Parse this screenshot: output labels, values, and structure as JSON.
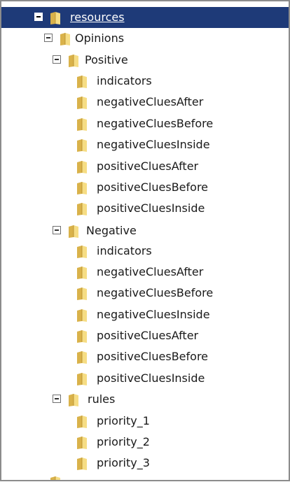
{
  "tree": {
    "root": {
      "label": "resources",
      "expanded": true,
      "selected": true
    },
    "opinions": {
      "label": "Opinions",
      "expanded": true
    },
    "positive": {
      "label": "Positive",
      "expanded": true,
      "children": [
        "indicators",
        "negativeCluesAfter",
        "negativeCluesBefore",
        "negativeCluesInside",
        "positiveCluesAfter",
        "positiveCluesBefore",
        "positiveCluesInside"
      ]
    },
    "negative": {
      "label": "Negative",
      "expanded": true,
      "children": [
        "indicators",
        "negativeCluesAfter",
        "negativeCluesBefore",
        "negativeCluesInside",
        "positiveCluesAfter",
        "positiveCluesBefore",
        "positiveCluesInside"
      ]
    },
    "rules": {
      "label": "rules",
      "expanded": true,
      "children": [
        "priority_1",
        "priority_2",
        "priority_3"
      ]
    }
  },
  "colors": {
    "selection_bg": "#1e3a78",
    "folder_light": "#f6dd84",
    "folder_dark": "#d9b24a",
    "border": "#8c8c8c"
  },
  "icons": {
    "folder": "folder-icon",
    "collapse": "collapse-toggle-icon"
  }
}
